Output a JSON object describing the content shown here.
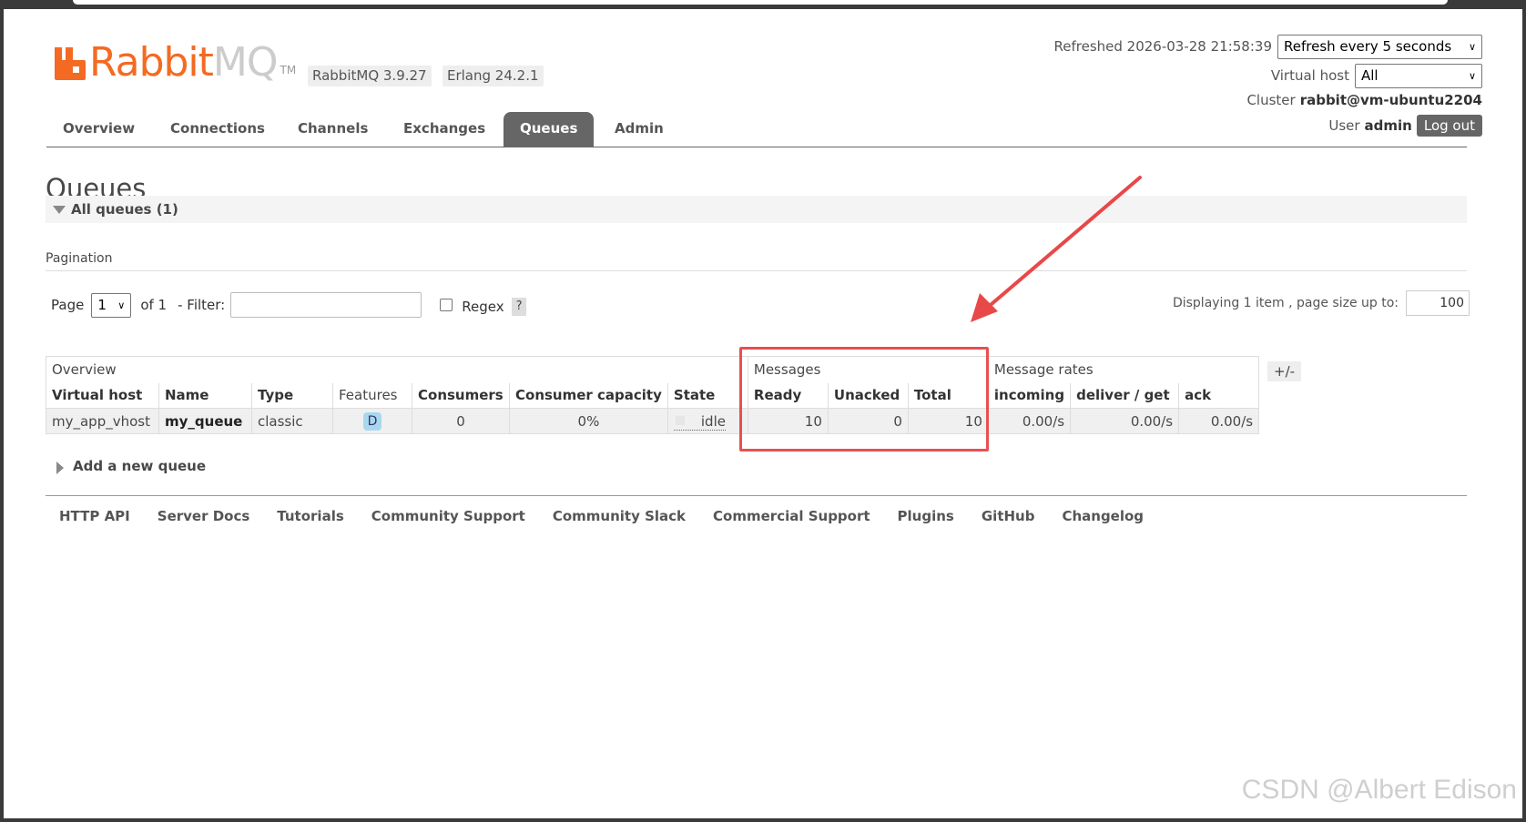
{
  "header": {
    "logo_text_rabbit": "Rabbit",
    "logo_text_mq": "MQ",
    "logo_tm": "TM",
    "rabbit_version": "RabbitMQ 3.9.27",
    "erlang_version": "Erlang 24.2.1",
    "refreshed_label": "Refreshed 2026-03-28 21:58:39",
    "refresh_select": "Refresh every 5 seconds",
    "vhost_label": "Virtual host",
    "vhost_select": "All",
    "cluster_label": "Cluster",
    "cluster_name": "rabbit@vm-ubuntu2204",
    "user_label": "User",
    "user_name": "admin",
    "logout_label": "Log out"
  },
  "tabs": [
    {
      "label": "Overview"
    },
    {
      "label": "Connections"
    },
    {
      "label": "Channels"
    },
    {
      "label": "Exchanges"
    },
    {
      "label": "Queues",
      "active": true
    },
    {
      "label": "Admin"
    }
  ],
  "main": {
    "title": "Queues",
    "section_title": "All queues (1)",
    "pagination_label": "Pagination",
    "page_label": "Page",
    "page_value": "1",
    "of_label": "of 1",
    "filter_label": "- Filter:",
    "filter_value": "",
    "regex_label": "Regex",
    "regex_help": "?",
    "displaying_label": "Displaying 1 item , page size up to:",
    "page_size": "100",
    "columns_toggle": "+/-",
    "add_queue_label": "Add a new queue"
  },
  "table": {
    "groups": [
      "Overview",
      "Messages",
      "Message rates"
    ],
    "headers": [
      "Virtual host",
      "Name",
      "Type",
      "Features",
      "Consumers",
      "Consumer capacity",
      "State",
      "Ready",
      "Unacked",
      "Total",
      "incoming",
      "deliver / get",
      "ack"
    ],
    "row": {
      "vhost": "my_app_vhost",
      "name": "my_queue",
      "type": "classic",
      "feature": "D",
      "consumers": "0",
      "consumer_capacity": "0%",
      "state": "idle",
      "ready": "10",
      "unacked": "0",
      "total": "10",
      "incoming": "0.00/s",
      "deliver_get": "0.00/s",
      "ack": "0.00/s"
    }
  },
  "footer": {
    "links": [
      "HTTP API",
      "Server Docs",
      "Tutorials",
      "Community Support",
      "Community Slack",
      "Commercial Support",
      "Plugins",
      "GitHub",
      "Changelog"
    ]
  },
  "watermark": "CSDN @Albert Edison",
  "colors": {
    "brand": "#f46a22",
    "tab_active": "#666666",
    "highlight": "#e85050"
  }
}
